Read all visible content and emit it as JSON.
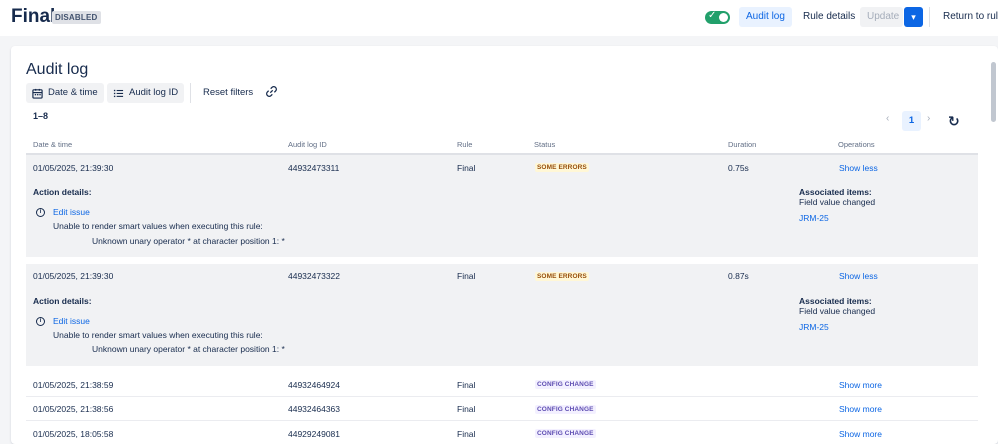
{
  "header": {
    "rule_name": "Final",
    "status_lozenge": "DISABLED",
    "toggle_enabled": true,
    "audit_log_label": "Audit log",
    "rule_details_label": "Rule details",
    "update_label": "Update",
    "return_label": "Return to rules",
    "chevron": "▾",
    "check": "✓"
  },
  "page": {
    "title": "Audit log",
    "filters": {
      "date_time_label": "Date & time",
      "audit_log_id_label": "Audit log ID",
      "reset_label": "Reset filters"
    },
    "count": "1–8",
    "pagination": {
      "current_page": "1",
      "prev": "‹",
      "next": "›"
    },
    "refresh_glyph": "↻"
  },
  "table": {
    "columns": [
      "Date & time",
      "Audit log ID",
      "Rule",
      "Status",
      "Duration",
      "Operations"
    ],
    "rows": [
      {
        "date": "01/05/2025, 21:39:30",
        "id": "44932473311",
        "rule": "Final",
        "status": "SOME ERRORS",
        "duration": "0.75s",
        "operation": "Show less",
        "details": {
          "title": "Action details:",
          "action": "Edit issue",
          "message": "Unable to render smart values when executing this rule:",
          "error": "Unknown unary operator * at character position 1: *",
          "assoc_title": "Associated items:",
          "assoc_desc": "Field value changed",
          "assoc_link": "JRM-25"
        }
      },
      {
        "date": "01/05/2025, 21:39:30",
        "id": "44932473322",
        "rule": "Final",
        "status": "SOME ERRORS",
        "duration": "0.87s",
        "operation": "Show less",
        "details": {
          "title": "Action details:",
          "action": "Edit issue",
          "message": "Unable to render smart values when executing this rule:",
          "error": "Unknown unary operator * at character position 1: *",
          "assoc_title": "Associated items:",
          "assoc_desc": "Field value changed",
          "assoc_link": "JRM-25"
        }
      },
      {
        "date": "01/05/2025, 21:38:59",
        "id": "44932464924",
        "rule": "Final",
        "status": "CONFIG CHANGE",
        "operation": "Show more"
      },
      {
        "date": "01/05/2025, 21:38:56",
        "id": "44932464363",
        "rule": "Final",
        "status": "CONFIG CHANGE",
        "operation": "Show more"
      },
      {
        "date": "01/05/2025, 18:05:58",
        "id": "44929249081",
        "rule": "Final",
        "status": "CONFIG CHANGE",
        "operation": "Show more"
      }
    ]
  },
  "colors": {
    "primary": "#0c66e4",
    "toggle_on": "#22a06b",
    "error_lozenge_bg": "#fff7d6",
    "error_lozenge_text": "#974f0c",
    "config_lozenge_bg": "#f3f0ff",
    "config_lozenge_text": "#5e4db2"
  },
  "icons": [
    "calendar-icon",
    "list-icon",
    "link-icon",
    "info-icon",
    "refresh-icon",
    "chevron-down-icon",
    "check-icon"
  ]
}
